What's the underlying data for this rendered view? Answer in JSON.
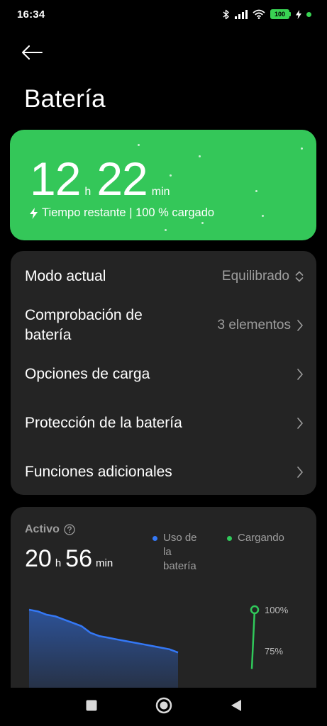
{
  "status_bar": {
    "time": "16:34",
    "battery_level": "100",
    "accent_color": "#39d353",
    "icons": [
      "bluetooth-icon",
      "signal-icon",
      "wifi-icon",
      "battery-icon",
      "charging-icon"
    ]
  },
  "header": {
    "back_icon": "arrow-left-icon",
    "title": "Batería"
  },
  "remaining": {
    "hours": "12",
    "hours_unit": "h",
    "minutes": "22",
    "minutes_unit": "min",
    "subtitle": "Tiempo restante | 100 % cargado",
    "card_color": "#34c759",
    "icon": "lightning-icon"
  },
  "settings": [
    {
      "label": "Modo actual",
      "value": "Equilibrado",
      "icon": "updown-chevron-icon"
    },
    {
      "label": "Comprobación de batería",
      "value": "3 elementos",
      "icon": "chevron-right-icon"
    },
    {
      "label": "Opciones de carga",
      "value": "",
      "icon": "chevron-right-icon"
    },
    {
      "label": "Protección de la batería",
      "value": "",
      "icon": "chevron-right-icon"
    },
    {
      "label": "Funciones adicionales",
      "value": "",
      "icon": "chevron-right-icon"
    }
  ],
  "activity": {
    "label": "Activo",
    "help_icon": "question-circle-icon",
    "hours": "20",
    "hours_unit": "h",
    "minutes": "56",
    "minutes_unit": "min",
    "legend": [
      {
        "name": "Uso de la batería",
        "color": "#3478f6"
      },
      {
        "name": "Cargando",
        "color": "#30c85a"
      }
    ],
    "chart_data": {
      "type": "area",
      "ytick_labels": [
        "100%",
        "75%"
      ],
      "series": [
        {
          "name": "Uso de la batería",
          "values_percent": [
            100,
            99,
            97,
            96,
            94,
            92,
            90,
            86,
            84,
            83,
            82,
            81,
            80,
            79,
            78,
            77,
            76,
            74
          ]
        },
        {
          "name": "Cargando",
          "values_percent": [
            64,
            100
          ]
        }
      ]
    }
  },
  "nav_bar": {
    "icons": [
      "square-recent-icon",
      "circle-home-icon",
      "triangle-back-icon"
    ]
  }
}
